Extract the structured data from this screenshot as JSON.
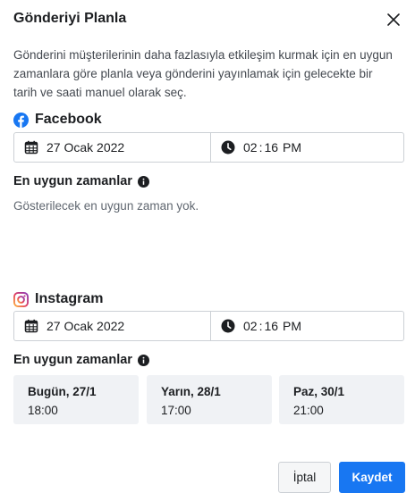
{
  "dialog": {
    "title": "Gönderiyi Planla",
    "description": "Gönderini müşterilerinin daha fazlasıyla etkileşim kurmak için en uygun zamanlara göre planla veya gönderini yayınlamak için gelecekte bir tarih ve saati manuel olarak seç."
  },
  "facebook": {
    "label": "Facebook",
    "date": "27 Ocak 2022",
    "time": {
      "hour": "02",
      "minute": "16",
      "ampm": "PM"
    },
    "best_times_label": "En uygun zamanlar",
    "empty_text": "Gösterilecek en uygun zaman yok."
  },
  "instagram": {
    "label": "Instagram",
    "date": "27 Ocak 2022",
    "time": {
      "hour": "02",
      "minute": "16",
      "ampm": "PM"
    },
    "best_times_label": "En uygun zamanlar",
    "slots": [
      {
        "day": "Bugün, 27/1",
        "hour": "18:00"
      },
      {
        "day": "Yarın, 28/1",
        "hour": "17:00"
      },
      {
        "day": "Paz, 30/1",
        "hour": "21:00"
      }
    ]
  },
  "footer": {
    "cancel_label": "İptal",
    "save_label": "Kaydet"
  },
  "colors": {
    "primary": "#1877f2",
    "facebook_blue": "#1877f2",
    "text": "#1c1e21",
    "muted": "#606770",
    "card_bg": "#f0f2f5"
  },
  "icons": {
    "close": "close-icon",
    "facebook": "facebook-icon",
    "instagram": "instagram-icon",
    "calendar": "calendar-icon",
    "clock": "clock-icon",
    "info": "info-icon"
  }
}
